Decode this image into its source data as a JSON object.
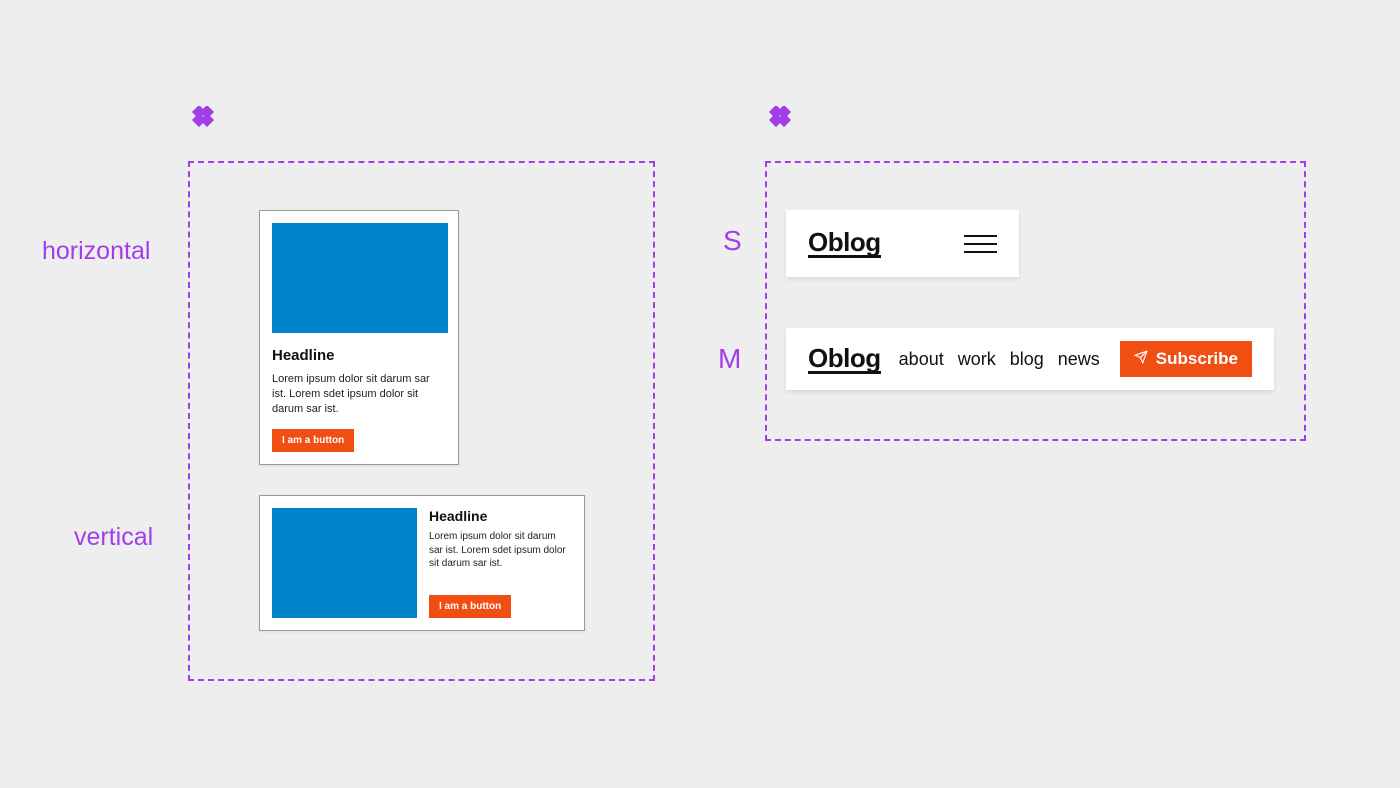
{
  "labels": {
    "horizontal": "horizontal",
    "vertical": "vertical",
    "s": "S",
    "m": "M"
  },
  "card_horizontal": {
    "title": "Headline",
    "body": "Lorem ipsum dolor sit darum sar ist. Lorem sdet ipsum dolor sit darum sar ist.",
    "button": "I am a button"
  },
  "card_vertical": {
    "title": "Headline",
    "body": "Lorem ipsum dolor sit darum sar ist. Lorem sdet ipsum dolor sit darum sar ist.",
    "button": "I am a button"
  },
  "navbar_s": {
    "logo": "Oblog"
  },
  "navbar_m": {
    "logo": "Oblog",
    "links": {
      "about": "about",
      "work": "work",
      "blog": "blog",
      "news": "news"
    },
    "subscribe": "Subscribe"
  },
  "colors": {
    "purple": "#a23ee8",
    "orange": "#f04e12",
    "blue": "#0084c9"
  }
}
